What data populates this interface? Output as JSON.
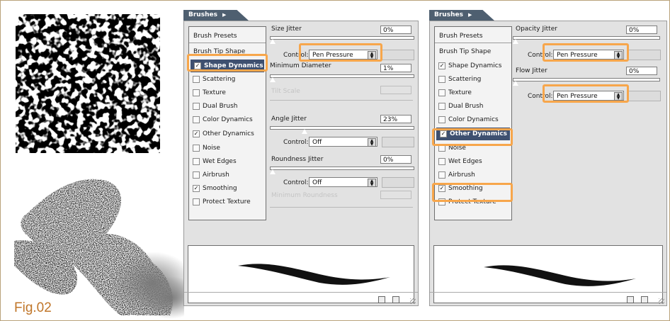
{
  "figure_label": "Fig.02",
  "panel_left": {
    "tab_title": "Brushes",
    "sidebar": [
      {
        "label": "Brush Presets",
        "type": "header"
      },
      {
        "label": "Brush Tip Shape",
        "type": "plain"
      },
      {
        "label": "Shape Dynamics",
        "type": "check",
        "checked": true,
        "selected": true
      },
      {
        "label": "Scattering",
        "type": "check",
        "checked": false
      },
      {
        "label": "Texture",
        "type": "check",
        "checked": false
      },
      {
        "label": "Dual Brush",
        "type": "check",
        "checked": false
      },
      {
        "label": "Color Dynamics",
        "type": "check",
        "checked": false
      },
      {
        "label": "Other Dynamics",
        "type": "check",
        "checked": true
      },
      {
        "label": "Noise",
        "type": "check",
        "checked": false
      },
      {
        "label": "Wet Edges",
        "type": "check",
        "checked": false
      },
      {
        "label": "Airbrush",
        "type": "check",
        "checked": false
      },
      {
        "label": "Smoothing",
        "type": "check",
        "checked": true
      },
      {
        "label": "Protect Texture",
        "type": "check",
        "checked": false
      }
    ],
    "size_jitter": {
      "label": "Size Jitter",
      "value": "0%",
      "control_label": "Control:",
      "control_value": "Pen Pressure"
    },
    "min_diameter": {
      "label": "Minimum Diameter",
      "value": "1%"
    },
    "tilt_scale": {
      "label": "Tilt Scale"
    },
    "angle_jitter": {
      "label": "Angle Jitter",
      "value": "23%",
      "control_label": "Control:",
      "control_value": "Off"
    },
    "roundness_jitter": {
      "label": "Roundness Jitter",
      "value": "0%",
      "control_label": "Control:",
      "control_value": "Off"
    },
    "min_roundness": {
      "label": "Minimum Roundness"
    }
  },
  "panel_right": {
    "tab_title": "Brushes",
    "sidebar": [
      {
        "label": "Brush Presets",
        "type": "header"
      },
      {
        "label": "Brush Tip Shape",
        "type": "plain"
      },
      {
        "label": "Shape Dynamics",
        "type": "check",
        "checked": true
      },
      {
        "label": "Scattering",
        "type": "check",
        "checked": false
      },
      {
        "label": "Texture",
        "type": "check",
        "checked": false
      },
      {
        "label": "Dual Brush",
        "type": "check",
        "checked": false
      },
      {
        "label": "Color Dynamics",
        "type": "check",
        "checked": false
      },
      {
        "label": "Other Dynamics",
        "type": "check",
        "checked": true,
        "selected": true
      },
      {
        "label": "Noise",
        "type": "check",
        "checked": false
      },
      {
        "label": "Wet Edges",
        "type": "check",
        "checked": false
      },
      {
        "label": "Airbrush",
        "type": "check",
        "checked": false
      },
      {
        "label": "Smoothing",
        "type": "check",
        "checked": true
      },
      {
        "label": "Protect Texture",
        "type": "check",
        "checked": false
      }
    ],
    "opacity_jitter": {
      "label": "Opacity Jitter",
      "value": "0%",
      "control_label": "Control:",
      "control_value": "Pen Pressure"
    },
    "flow_jitter": {
      "label": "Flow Jitter",
      "value": "0%",
      "control_label": "Control:",
      "control_value": "Pen Pressure"
    }
  },
  "colors": {
    "highlight": "#f7a64b",
    "tab": "#4e5f70",
    "selection": "#3e5070",
    "figure_label": "#c0762a"
  },
  "icons": [
    "flyout-arrow-icon",
    "new-preset-icon",
    "trash-icon",
    "resize-grip-icon",
    "dropdown-arrow-icon",
    "checkbox-icon"
  ]
}
